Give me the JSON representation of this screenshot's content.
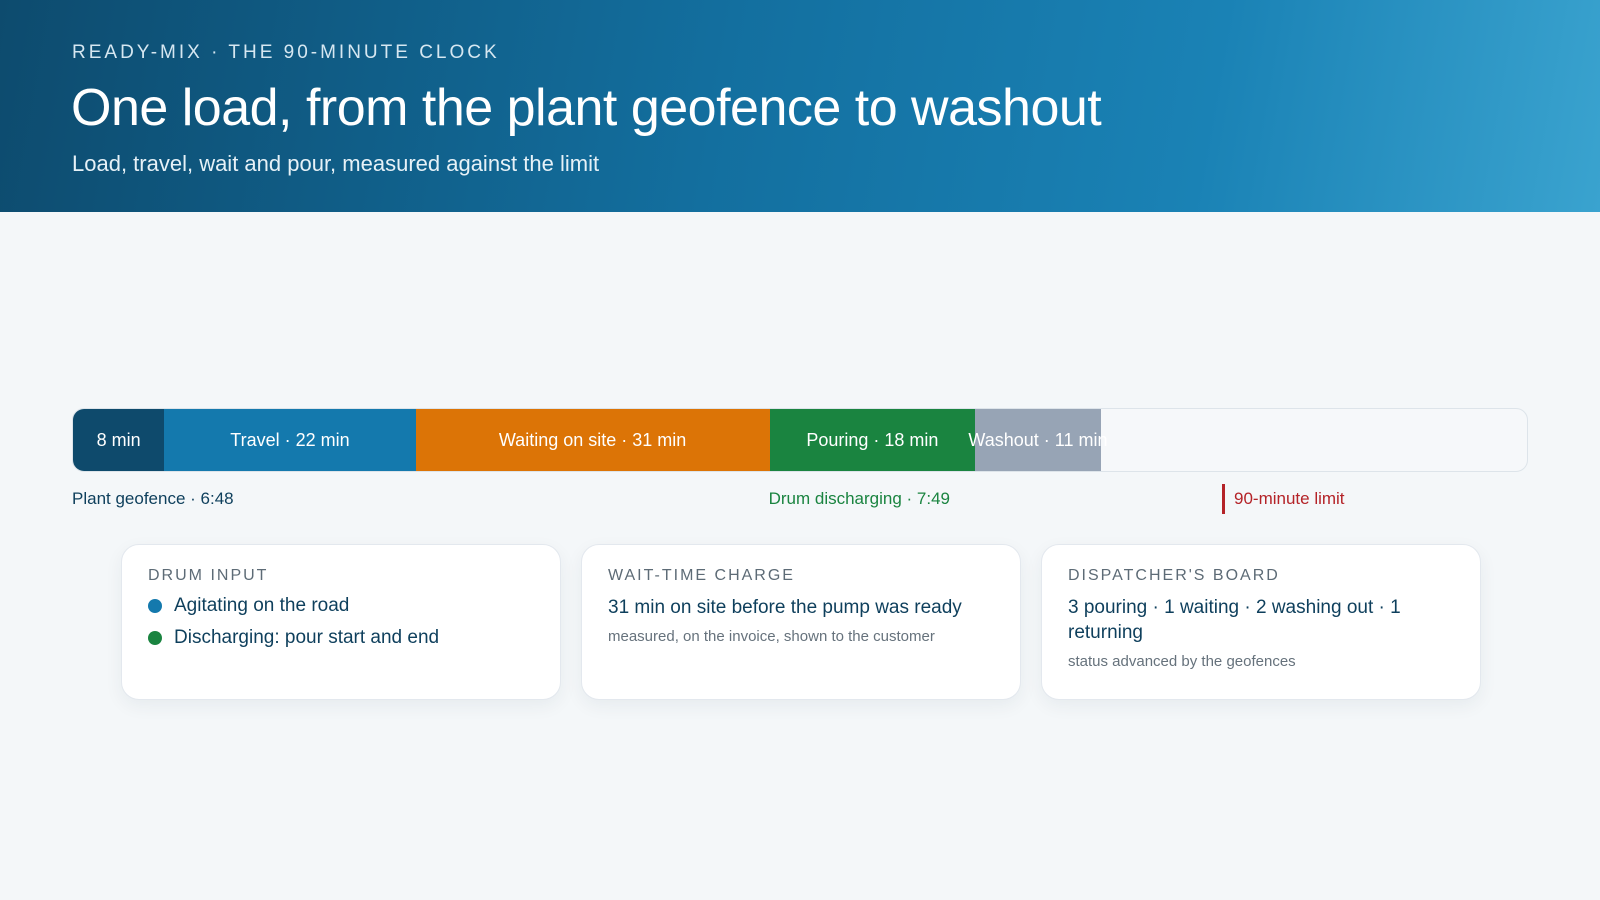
{
  "header": {
    "eyebrow": "READY-MIX · THE 90-MINUTE CLOCK",
    "title": "One load, from the plant geofence to washout",
    "subtitle": "Load, travel, wait and pour, measured against the limit"
  },
  "timeline": {
    "limit_minutes": 90,
    "segments": [
      {
        "label": "8 min",
        "minutes": 8,
        "color": "#0e4a6c"
      },
      {
        "label": "Travel · 22 min",
        "minutes": 22,
        "color": "#1479ad"
      },
      {
        "label": "Waiting on site · 31 min",
        "minutes": 31,
        "color": "#dc7406"
      },
      {
        "label": "Pouring · 18 min",
        "minutes": 18,
        "color": "#1a8440"
      },
      {
        "label": "Washout · 11 min",
        "minutes": 11,
        "color": "#97a4b5"
      }
    ],
    "markers": {
      "start": "Plant geofence · 6:48",
      "discharge": "Drum discharging · 7:49",
      "limit": "90-minute limit"
    },
    "colors": {
      "start_label": "#0e3f5c",
      "discharge_label": "#1a8440",
      "limit_label": "#b42328"
    }
  },
  "cards": {
    "drum": {
      "title": "DRUM INPUT",
      "items": [
        {
          "text": "Agitating on the road",
          "color": "#1479ad"
        },
        {
          "text": "Discharging: pour start and end",
          "color": "#1a8440"
        }
      ]
    },
    "wait": {
      "title": "WAIT-TIME CHARGE",
      "main": "31 min on site before the pump was ready",
      "note": "measured, on the invoice, shown to the customer"
    },
    "board": {
      "title": "DISPATCHER'S BOARD",
      "main": "3 pouring · 1 waiting · 2 washing out · 1 returning",
      "note": "status advanced by the geofences"
    }
  }
}
